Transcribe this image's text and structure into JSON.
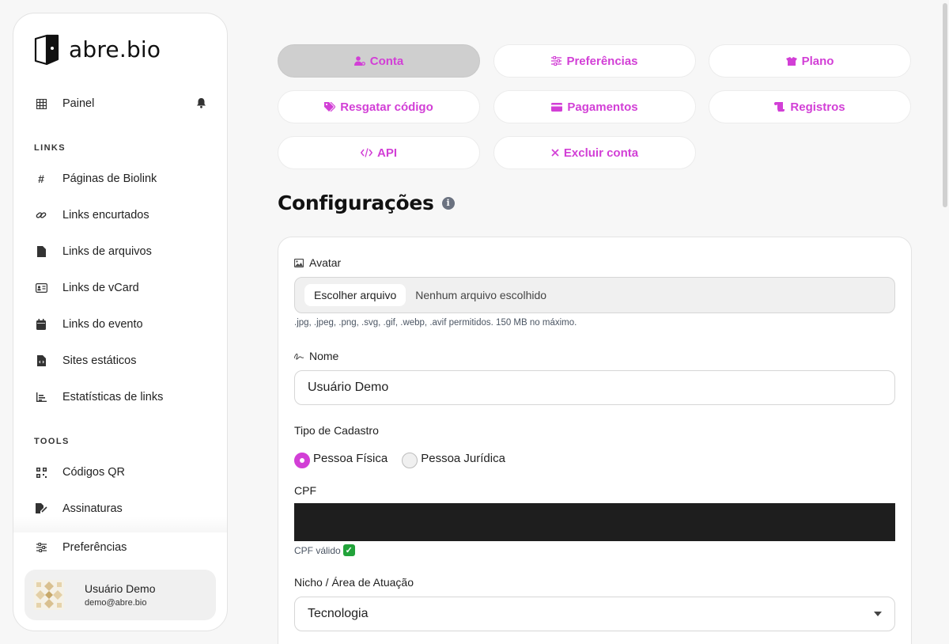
{
  "brand": {
    "name": "abre.bio",
    "accent": "#d23fd6"
  },
  "sidebar": {
    "top_item": {
      "label": "Painel",
      "icon": "grid-icon"
    },
    "sections": [
      {
        "title": "LINKS"
      },
      {
        "title": "TOOLS"
      }
    ],
    "links_items": [
      {
        "label": "Páginas de Biolink",
        "icon": "hashtag-icon"
      },
      {
        "label": "Links encurtados",
        "icon": "link-icon"
      },
      {
        "label": "Links de arquivos",
        "icon": "file-icon"
      },
      {
        "label": "Links de vCard",
        "icon": "id-card-icon"
      },
      {
        "label": "Links do evento",
        "icon": "calendar-icon"
      },
      {
        "label": "Sites estáticos",
        "icon": "file-code-icon"
      },
      {
        "label": "Estatísticas de links",
        "icon": "chart-icon"
      }
    ],
    "tools_items": [
      {
        "label": "Códigos QR",
        "icon": "qrcode-icon"
      },
      {
        "label": "Assinaturas",
        "icon": "signature-icon"
      }
    ],
    "preferences": {
      "label": "Preferências",
      "icon": "sliders-icon"
    },
    "user": {
      "name": "Usuário Demo",
      "email": "demo@abre.bio"
    }
  },
  "tabs": [
    {
      "label": "Conta",
      "icon": "user-cog-icon",
      "active": true
    },
    {
      "label": "Preferências",
      "icon": "sliders-icon",
      "active": false
    },
    {
      "label": "Plano",
      "icon": "box-icon",
      "active": false
    },
    {
      "label": "Resgatar código",
      "icon": "tags-icon",
      "active": false
    },
    {
      "label": "Pagamentos",
      "icon": "credit-card-icon",
      "active": false
    },
    {
      "label": "Registros",
      "icon": "scroll-icon",
      "active": false
    },
    {
      "label": "API",
      "icon": "code-icon",
      "active": false
    },
    {
      "label": "Excluir conta",
      "icon": "times-icon",
      "active": false
    }
  ],
  "page": {
    "title": "Configurações"
  },
  "form": {
    "avatar": {
      "label": "Avatar",
      "button": "Escolher arquivo",
      "status": "Nenhum arquivo escolhido",
      "hint": ".jpg, .jpeg, .png, .svg, .gif, .webp, .avif permitidos. 150 MB no máximo."
    },
    "name": {
      "label": "Nome",
      "value": "Usuário Demo"
    },
    "tipo": {
      "label": "Tipo de Cadastro",
      "options": [
        "Pessoa Física",
        "Pessoa Jurídica"
      ],
      "selected": "Pessoa Física"
    },
    "cpf": {
      "label": "CPF",
      "status": "CPF válido"
    },
    "nicho": {
      "label": "Nicho / Área de Atuação",
      "value": "Tecnologia"
    }
  }
}
